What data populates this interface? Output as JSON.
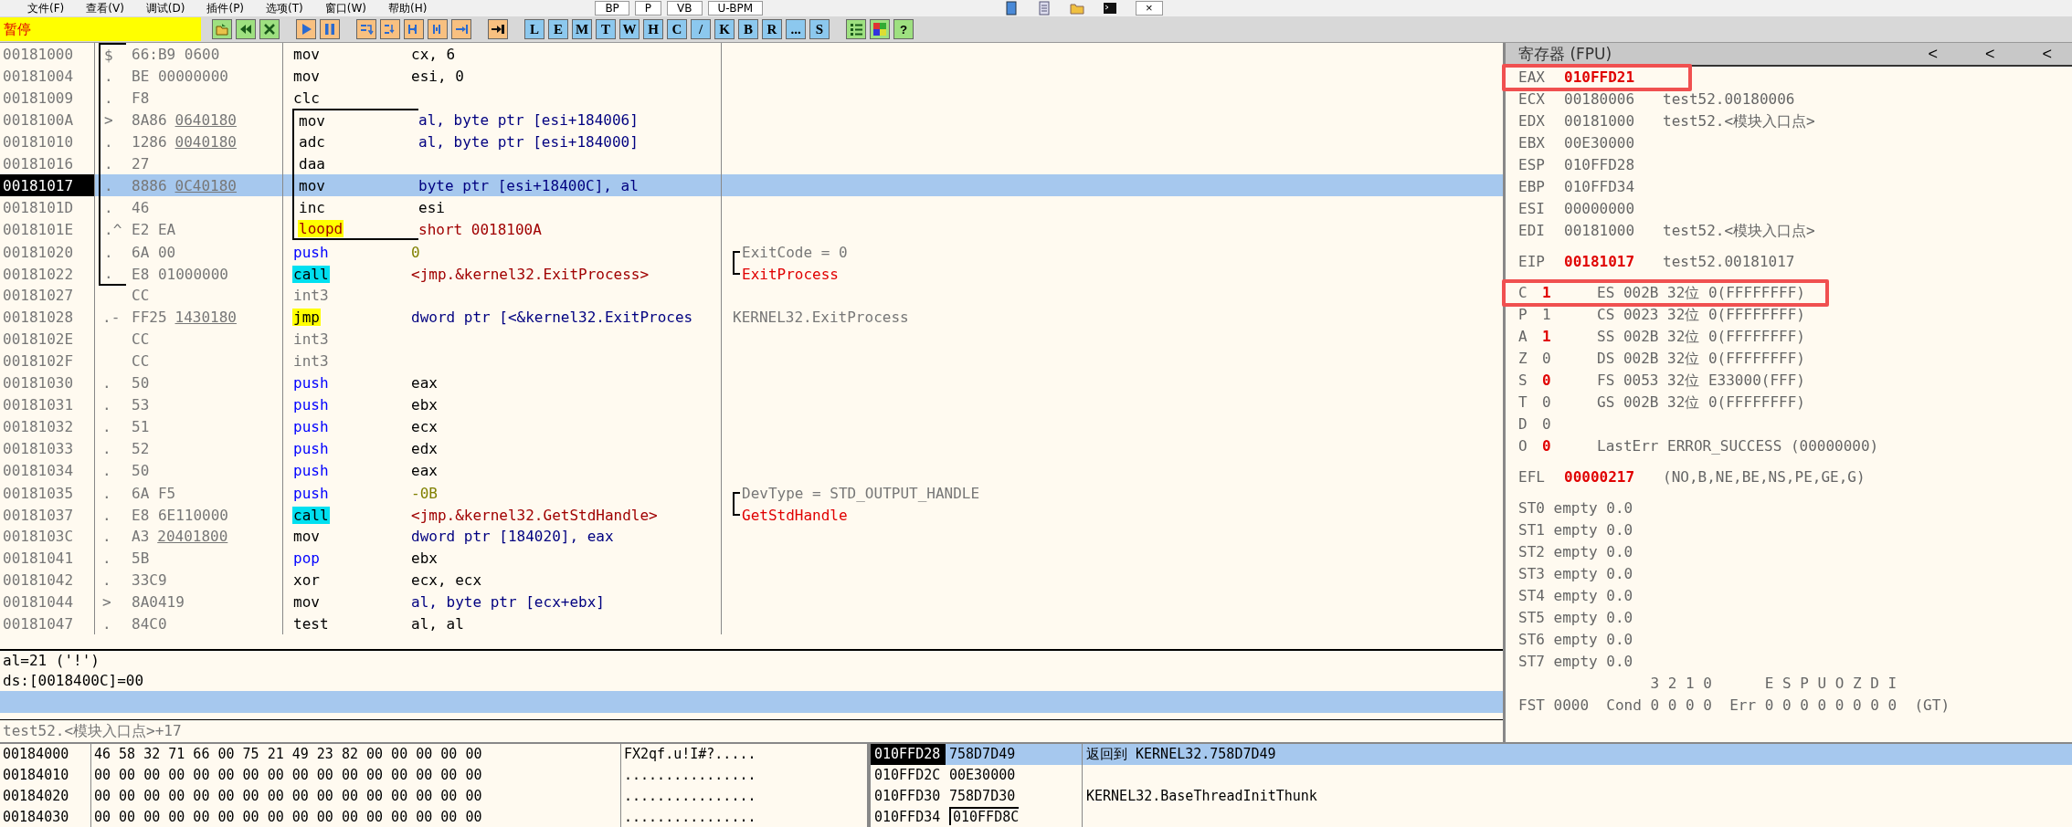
{
  "menu": {
    "items": [
      "文件(F)",
      "查看(V)",
      "调试(D)",
      "插件(P)",
      "选项(T)",
      "窗口(W)",
      "帮助(H)"
    ],
    "right_buttons": [
      "BP",
      "P",
      "VB",
      "U-BPM"
    ],
    "window_icons": [
      {
        "kind": "book"
      },
      {
        "kind": "page"
      },
      {
        "kind": "folder"
      },
      {
        "kind": "terminal"
      }
    ],
    "close": "×"
  },
  "toolbar": {
    "status": "暂停",
    "icon_buttons": [
      {
        "kind": "open"
      },
      {
        "kind": "rewind"
      },
      {
        "kind": "close"
      },
      {
        "kind": "run"
      },
      {
        "kind": "pause"
      },
      {
        "kind": "step-into"
      },
      {
        "kind": "step-over"
      },
      {
        "kind": "trace-into"
      },
      {
        "kind": "trace-over"
      },
      {
        "kind": "till-return"
      },
      {
        "kind": "goto"
      }
    ],
    "letter_buttons": [
      "L",
      "E",
      "M",
      "T",
      "W",
      "H",
      "C",
      "/",
      "K",
      "B",
      "R",
      "...",
      "S"
    ],
    "tail_buttons": [
      {
        "kind": "list"
      },
      {
        "kind": "grid"
      },
      {
        "kind": "help",
        "label": "?"
      }
    ]
  },
  "disassembly": {
    "rows": [
      {
        "address": "00181000",
        "mark": "$",
        "bytes": "66:B9 0600",
        "mnemonic": {
          "text": "mov",
          "kind": "plain"
        },
        "operands": {
          "text": "cx, 6",
          "kind": "reg"
        },
        "in_function": true,
        "in_loop": false,
        "selected": false
      },
      {
        "address": "00181004",
        "mark": ".",
        "bytes": "BE 00000000",
        "mnemonic": {
          "text": "mov",
          "kind": "plain"
        },
        "operands": {
          "text": "esi, 0",
          "kind": "reg"
        },
        "in_function": true,
        "in_loop": false,
        "selected": false
      },
      {
        "address": "00181009",
        "mark": ".",
        "bytes": "F8",
        "mnemonic": {
          "text": "clc",
          "kind": "plain"
        },
        "in_function": true,
        "in_loop": false,
        "selected": false
      },
      {
        "address": "0018100A",
        "mark": ">",
        "bytes": "8A86",
        "bytes_link": "0640180",
        "mnemonic": {
          "text": "mov",
          "kind": "plain"
        },
        "operands": {
          "text": "al, byte ptr [esi+184006]",
          "kind": "mem"
        },
        "in_function": true,
        "in_loop": true,
        "selected": false
      },
      {
        "address": "00181010",
        "mark": ".",
        "bytes": "1286",
        "bytes_link": "0040180",
        "mnemonic": {
          "text": "adc",
          "kind": "plain"
        },
        "operands": {
          "text": "al, byte ptr [esi+184000]",
          "kind": "mem"
        },
        "in_function": true,
        "in_loop": true,
        "selected": false
      },
      {
        "address": "00181016",
        "mark": ".",
        "bytes": "27",
        "mnemonic": {
          "text": "daa",
          "kind": "plain"
        },
        "in_function": true,
        "in_loop": true,
        "selected": false
      },
      {
        "address": "00181017",
        "mark": ".",
        "bytes": "8886",
        "bytes_link": "0C40180",
        "mnemonic": {
          "text": "mov",
          "kind": "plain"
        },
        "operands": {
          "text": "byte ptr [esi+18400C], al",
          "kind": "mem"
        },
        "in_function": true,
        "in_loop": true,
        "selected": true
      },
      {
        "address": "0018101D",
        "mark": ".",
        "bytes": "46",
        "mnemonic": {
          "text": "inc",
          "kind": "plain"
        },
        "operands": {
          "text": "esi",
          "kind": "reg"
        },
        "in_function": true,
        "in_loop": true,
        "selected": false
      },
      {
        "address": "0018101E",
        "mark": ".^",
        "bytes": "E2 EA",
        "mnemonic": {
          "text": "loopd",
          "kind": "loop"
        },
        "operands": {
          "text": "short 0018100A",
          "kind": "target"
        },
        "in_function": true,
        "in_loop": true,
        "selected": false
      },
      {
        "address": "00181020",
        "mark": ".",
        "bytes": "6A 00",
        "mnemonic": {
          "text": "push",
          "kind": "push"
        },
        "operands": {
          "text": "0",
          "kind": "imm"
        },
        "comment": {
          "text": "ExitCode = 0",
          "kind": "arg"
        },
        "in_function": true,
        "in_loop": false,
        "selected": false
      },
      {
        "address": "00181022",
        "mark": ".",
        "bytes": "E8 01000000",
        "mnemonic": {
          "text": "call",
          "kind": "call"
        },
        "operands": {
          "text": "<jmp.&kernel32.ExitProcess>",
          "kind": "target"
        },
        "comment": {
          "text": "ExitProcess",
          "kind": "api"
        },
        "in_function": true,
        "in_loop": false,
        "selected": false
      },
      {
        "address": "00181027",
        "bytes": "CC",
        "mnemonic": {
          "text": "int3",
          "kind": "filler"
        },
        "in_function": false,
        "in_loop": false,
        "selected": false
      },
      {
        "address": "00181028",
        "mark": ".-",
        "bytes": "FF25",
        "bytes_link": "1430180",
        "mnemonic": {
          "text": "jmp",
          "kind": "jump"
        },
        "operands": {
          "text": "dword ptr [<&kernel32.ExitProces",
          "kind": "mem"
        },
        "comment": {
          "text": "KERNEL32.ExitProcess",
          "kind": "info"
        },
        "in_function": false,
        "in_loop": false,
        "selected": false
      },
      {
        "address": "0018102E",
        "bytes": "CC",
        "mnemonic": {
          "text": "int3",
          "kind": "filler"
        },
        "in_function": false,
        "in_loop": false,
        "selected": false
      },
      {
        "address": "0018102F",
        "bytes": "CC",
        "mnemonic": {
          "text": "int3",
          "kind": "filler"
        },
        "in_function": false,
        "in_loop": false,
        "selected": false
      },
      {
        "address": "00181030",
        "mark": ".",
        "bytes": "50",
        "mnemonic": {
          "text": "push",
          "kind": "push"
        },
        "operands": {
          "text": "eax",
          "kind": "reg"
        },
        "in_function": false,
        "in_loop": false,
        "selected": false
      },
      {
        "address": "00181031",
        "mark": ".",
        "bytes": "53",
        "mnemonic": {
          "text": "push",
          "kind": "push"
        },
        "operands": {
          "text": "ebx",
          "kind": "reg"
        },
        "in_function": false,
        "in_loop": false,
        "selected": false
      },
      {
        "address": "00181032",
        "mark": ".",
        "bytes": "51",
        "mnemonic": {
          "text": "push",
          "kind": "push"
        },
        "operands": {
          "text": "ecx",
          "kind": "reg"
        },
        "in_function": false,
        "in_loop": false,
        "selected": false
      },
      {
        "address": "00181033",
        "mark": ".",
        "bytes": "52",
        "mnemonic": {
          "text": "push",
          "kind": "push"
        },
        "operands": {
          "text": "edx",
          "kind": "reg"
        },
        "in_function": false,
        "in_loop": false,
        "selected": false
      },
      {
        "address": "00181034",
        "mark": ".",
        "bytes": "50",
        "mnemonic": {
          "text": "push",
          "kind": "push"
        },
        "operands": {
          "text": "eax",
          "kind": "reg"
        },
        "in_function": false,
        "in_loop": false,
        "selected": false
      },
      {
        "address": "00181035",
        "mark": ".",
        "bytes": "6A F5",
        "mnemonic": {
          "text": "push",
          "kind": "push"
        },
        "operands": {
          "text": "-0B",
          "kind": "imm"
        },
        "comment": {
          "text": "DevType = STD_OUTPUT_HANDLE",
          "kind": "arg"
        },
        "in_function": false,
        "in_loop": false,
        "selected": false
      },
      {
        "address": "00181037",
        "mark": ".",
        "bytes": "E8 6E110000",
        "mnemonic": {
          "text": "call",
          "kind": "call"
        },
        "operands": {
          "text": "<jmp.&kernel32.GetStdHandle>",
          "kind": "target"
        },
        "comment": {
          "text": "GetStdHandle",
          "kind": "api"
        },
        "in_function": false,
        "in_loop": false,
        "selected": false
      },
      {
        "address": "0018103C",
        "mark": ".",
        "bytes": "A3",
        "bytes_link": "20401800",
        "mnemonic": {
          "text": "mov",
          "kind": "plain"
        },
        "operands": {
          "text": "dword ptr [184020], eax",
          "kind": "mem"
        },
        "in_function": false,
        "in_loop": false,
        "selected": false
      },
      {
        "address": "00181041",
        "mark": ".",
        "bytes": "5B",
        "mnemonic": {
          "text": "pop",
          "kind": "push"
        },
        "operands": {
          "text": "ebx",
          "kind": "reg"
        },
        "in_function": false,
        "in_loop": false,
        "selected": false
      },
      {
        "address": "00181042",
        "mark": ".",
        "bytes": "33C9",
        "mnemonic": {
          "text": "xor",
          "kind": "plain"
        },
        "operands": {
          "text": "ecx, ecx",
          "kind": "reg"
        },
        "in_function": false,
        "in_loop": false,
        "selected": false
      },
      {
        "address": "00181044",
        "mark": ">",
        "bytes": "8A0419",
        "mnemonic": {
          "text": "mov",
          "kind": "plain"
        },
        "operands": {
          "text": "al, byte ptr [ecx+ebx]",
          "kind": "mem"
        },
        "in_function": false,
        "in_loop": false,
        "selected": false
      },
      {
        "address": "00181047",
        "mark": ".",
        "bytes": "84C0",
        "mnemonic": {
          "text": "test",
          "kind": "plain"
        },
        "operands": {
          "text": "al, al",
          "kind": "reg"
        },
        "in_function": false,
        "in_loop": false,
        "selected": false
      }
    ]
  },
  "info": {
    "lines": [
      "al=21 ('!')",
      "ds:[0018400C]=00"
    ],
    "location": "test52.<模块入口点>+17"
  },
  "registers": {
    "title": "寄存器 (FPU)",
    "header_buttons": [
      "<",
      "<",
      "<"
    ],
    "general": [
      {
        "name": "EAX",
        "value": "010FFD21",
        "changed": true,
        "annotated": true
      },
      {
        "name": "ECX",
        "value": "00180006",
        "comment": "test52.00180006",
        "changed": false,
        "annotated": false
      },
      {
        "name": "EDX",
        "value": "00181000",
        "comment": "test52.<模块入口点>",
        "changed": false,
        "annotated": false
      },
      {
        "name": "EBX",
        "value": "00E30000",
        "changed": false,
        "annotated": false
      },
      {
        "name": "ESP",
        "value": "010FFD28",
        "changed": false,
        "annotated": false
      },
      {
        "name": "EBP",
        "value": "010FFD34",
        "changed": false,
        "annotated": false
      },
      {
        "name": "ESI",
        "value": "00000000",
        "changed": false,
        "annotated": false
      },
      {
        "name": "EDI",
        "value": "00181000",
        "comment": "test52.<模块入口点>",
        "changed": false,
        "annotated": false
      }
    ],
    "eip": {
      "name": "EIP",
      "value": "00181017",
      "comment": "test52.00181017",
      "changed": true
    },
    "flags": [
      {
        "name": "C",
        "value": "1",
        "changed": true,
        "segment": "ES 002B 32位 0(FFFFFFFF)",
        "annotated": true
      },
      {
        "name": "P",
        "value": "1",
        "changed": false,
        "segment": "CS 0023 32位 0(FFFFFFFF)",
        "annotated": false
      },
      {
        "name": "A",
        "value": "1",
        "changed": true,
        "segment": "SS 002B 32位 0(FFFFFFFF)",
        "annotated": false
      },
      {
        "name": "Z",
        "value": "0",
        "changed": false,
        "segment": "DS 002B 32位 0(FFFFFFFF)",
        "annotated": false
      },
      {
        "name": "S",
        "value": "0",
        "changed": true,
        "segment": "FS 0053 32位 E33000(FFF)",
        "annotated": false
      },
      {
        "name": "T",
        "value": "0",
        "changed": false,
        "segment": "GS 002B 32位 0(FFFFFFFF)",
        "annotated": false
      },
      {
        "name": "D",
        "value": "0",
        "changed": false,
        "annotated": false
      },
      {
        "name": "O",
        "value": "0",
        "changed": true,
        "segment": "LastErr ERROR_SUCCESS (00000000)",
        "annotated": false
      }
    ],
    "efl": {
      "name": "EFL",
      "value": "00000217",
      "comment": "(NO,B,NE,BE,NS,PE,GE,G)",
      "changed": true
    },
    "fpu": [
      "ST0 empty 0.0",
      "ST1 empty 0.0",
      "ST2 empty 0.0",
      "ST3 empty 0.0",
      "ST4 empty 0.0",
      "ST5 empty 0.0",
      "ST6 empty 0.0",
      "ST7 empty 0.0"
    ],
    "fst_header": "               3 2 1 0      E S P U O Z D I",
    "fst": "FST 0000  Cond 0 0 0 0  Err 0 0 0 0 0 0 0 0  (GT)"
  },
  "dump": {
    "rows": [
      {
        "address": "00184000",
        "hex": "46 58 32 71 66 00 75 21 49 23 82 00 00 00 00 00",
        "ascii": "FX2qf.u!I#?....."
      },
      {
        "address": "00184010",
        "hex": "00 00 00 00 00 00 00 00 00 00 00 00 00 00 00 00",
        "ascii": "................"
      },
      {
        "address": "00184020",
        "hex": "00 00 00 00 00 00 00 00 00 00 00 00 00 00 00 00",
        "ascii": "................"
      },
      {
        "address": "00184030",
        "hex": "00 00 00 00 00 00 00 00 00 00 00 00 00 00 00 00",
        "ascii": "................"
      }
    ]
  },
  "stack": {
    "rows": [
      {
        "address": "010FFD28",
        "value": "758D7D49",
        "comment": "返回到 KERNEL32.758D7D49",
        "selected": true
      },
      {
        "address": "010FFD2C",
        "value": "00E30000",
        "selected": false
      },
      {
        "address": "010FFD30",
        "value": "758D7D30",
        "comment": "KERNEL32.BaseThreadInitThunk",
        "selected": false
      },
      {
        "address": "010FFD34",
        "value": "010FFD8C",
        "frame": true,
        "selected": false
      }
    ]
  }
}
